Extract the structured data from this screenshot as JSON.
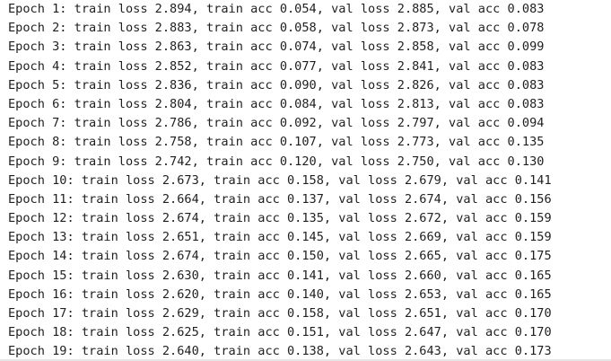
{
  "log": {
    "lines": [
      "Epoch 1: train loss 2.894, train acc 0.054, val loss 2.885, val acc 0.083",
      "Epoch 2: train loss 2.883, train acc 0.058, val loss 2.873, val acc 0.078",
      "Epoch 3: train loss 2.863, train acc 0.074, val loss 2.858, val acc 0.099",
      "Epoch 4: train loss 2.852, train acc 0.077, val loss 2.841, val acc 0.083",
      "Epoch 5: train loss 2.836, train acc 0.090, val loss 2.826, val acc 0.083",
      "Epoch 6: train loss 2.804, train acc 0.084, val loss 2.813, val acc 0.083",
      "Epoch 7: train loss 2.786, train acc 0.092, val loss 2.797, val acc 0.094",
      "Epoch 8: train loss 2.758, train acc 0.107, val loss 2.773, val acc 0.135",
      "Epoch 9: train loss 2.742, train acc 0.120, val loss 2.750, val acc 0.130",
      "Epoch 10: train loss 2.673, train acc 0.158, val loss 2.679, val acc 0.141",
      "Epoch 11: train loss 2.664, train acc 0.137, val loss 2.674, val acc 0.156",
      "Epoch 12: train loss 2.674, train acc 0.135, val loss 2.672, val acc 0.159",
      "Epoch 13: train loss 2.651, train acc 0.145, val loss 2.669, val acc 0.159",
      "Epoch 14: train loss 2.674, train acc 0.150, val loss 2.665, val acc 0.175",
      "Epoch 15: train loss 2.630, train acc 0.141, val loss 2.660, val acc 0.165",
      "Epoch 16: train loss 2.620, train acc 0.140, val loss 2.653, val acc 0.165",
      "Epoch 17: train loss 2.629, train acc 0.158, val loss 2.651, val acc 0.170",
      "Epoch 18: train loss 2.625, train acc 0.151, val loss 2.647, val acc 0.170",
      "Epoch 19: train loss 2.640, train acc 0.138, val loss 2.643, val acc 0.173"
    ]
  },
  "colors": {
    "text": "#1f1f1f",
    "background": "#ffffff"
  }
}
